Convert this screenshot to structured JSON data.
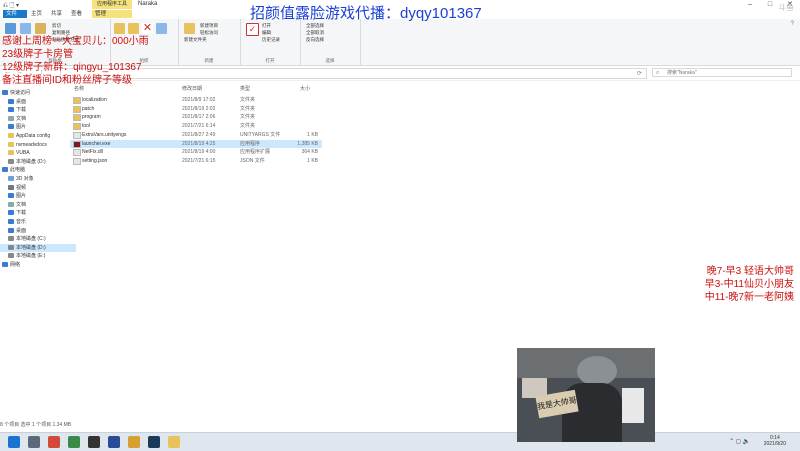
{
  "window": {
    "title": "Naraka",
    "context_tab": "应用程序工具",
    "context_group": "管理",
    "qa_icons": "⎌ 🗋 ▾"
  },
  "ribbon_tabs": [
    "文件",
    "主页",
    "共享",
    "查看"
  ],
  "ribbon": {
    "groups": [
      {
        "label": "剪贴板",
        "items": [
          "固定到快速访问",
          "复制",
          "粘贴",
          "剪切",
          "复制路径",
          "粘贴快捷方式"
        ]
      },
      {
        "label": "组织",
        "items": [
          "移动到",
          "复制到",
          "删除",
          "重命名"
        ]
      },
      {
        "label": "新建",
        "items": [
          "新建文件夹",
          "新建项目",
          "轻松访问"
        ]
      },
      {
        "label": "打开",
        "items": [
          "属性",
          "打开",
          "编辑",
          "历史记录"
        ]
      },
      {
        "label": "选择",
        "items": [
          "全部选择",
          "全部取消",
          "反向选择"
        ]
      }
    ]
  },
  "search": {
    "placeholder": "搜索\"Naraka\""
  },
  "sidebar": [
    {
      "label": "快速访问",
      "icon": "star-icon",
      "color": "#3a7bd5"
    },
    {
      "label": "桌面",
      "icon": "desktop-icon",
      "color": "#3a7bd5"
    },
    {
      "label": "下载",
      "icon": "download-icon",
      "color": "#3a7bd5"
    },
    {
      "label": "文档",
      "icon": "document-icon",
      "color": "#8aa"
    },
    {
      "label": "图片",
      "icon": "picture-icon",
      "color": "#3a7bd5"
    },
    {
      "label": "AppData config",
      "icon": "folder-icon",
      "color": "#e8c25a"
    },
    {
      "label": "nvmeadvdocs",
      "icon": "folder-icon",
      "color": "#e8c25a"
    },
    {
      "label": "VUBA",
      "icon": "folder-icon",
      "color": "#e8c25a"
    },
    {
      "label": "本地磁盘 (D:)",
      "icon": "drive-icon",
      "color": "#888"
    },
    {
      "label": "此电脑",
      "icon": "computer-icon",
      "color": "#3a7bd5"
    },
    {
      "label": "3D 对象",
      "icon": "cube-icon",
      "color": "#6aa0d8"
    },
    {
      "label": "视频",
      "icon": "video-icon",
      "color": "#6a7a8a"
    },
    {
      "label": "图片",
      "icon": "picture-icon",
      "color": "#3a7bd5"
    },
    {
      "label": "文档",
      "icon": "document-icon",
      "color": "#8aa"
    },
    {
      "label": "下载",
      "icon": "download-icon",
      "color": "#3a7bd5"
    },
    {
      "label": "音乐",
      "icon": "music-icon",
      "color": "#3a7bd5"
    },
    {
      "label": "桌面",
      "icon": "desktop-icon",
      "color": "#3a7bd5"
    },
    {
      "label": "本地磁盘 (C:)",
      "icon": "drive-icon",
      "color": "#888"
    },
    {
      "label": "本地磁盘 (D:)",
      "icon": "drive-icon",
      "color": "#888"
    },
    {
      "label": "本地磁盘 (E:)",
      "icon": "drive-icon",
      "color": "#888"
    },
    {
      "label": "网络",
      "icon": "network-icon",
      "color": "#3a7bd5"
    }
  ],
  "sidebar_selected": 18,
  "columns": [
    "名称",
    "修改日期",
    "类型",
    "大小"
  ],
  "files": [
    {
      "name": "localization",
      "date": "2021/8/9 17:02",
      "type": "文件夹",
      "size": "",
      "icon": "folder-icon"
    },
    {
      "name": "patch",
      "date": "2021/8/19 2:02",
      "type": "文件夹",
      "size": "",
      "icon": "folder-icon"
    },
    {
      "name": "program",
      "date": "2021/8/17 2:06",
      "type": "文件夹",
      "size": "",
      "icon": "folder-icon"
    },
    {
      "name": "tool",
      "date": "2021/7/21 6:14",
      "type": "文件夹",
      "size": "",
      "icon": "folder-icon"
    },
    {
      "name": "ExtraVars.unityengs",
      "date": "2021/8/27 2:49",
      "type": "UNITYARGS 文件",
      "size": "1 KB",
      "icon": "file-icon"
    },
    {
      "name": "launcher.exe",
      "date": "2021/8/19 4:25",
      "type": "应用程序",
      "size": "1,385 KB",
      "icon": "app-icon"
    },
    {
      "name": "NetFix.dll",
      "date": "2021/8/19 4:00",
      "type": "应用程序扩展",
      "size": "364 KB",
      "icon": "file-icon"
    },
    {
      "name": "setting.json",
      "date": "2021/7/21 6:15",
      "type": "JSON 文件",
      "size": "1 KB",
      "icon": "file-icon"
    }
  ],
  "selected_file": 5,
  "status": "8 个项目   选中 1 个项目  1.34 MB",
  "taskbar": {
    "apps": [
      {
        "name": "windows-start-icon",
        "color": "#1a73d0"
      },
      {
        "name": "search-taskbar-icon",
        "color": "#5a6a7a"
      },
      {
        "name": "chrome-icon",
        "color": "#d24a3a"
      },
      {
        "name": "game-icon",
        "color": "#3a8a4a"
      },
      {
        "name": "obs-icon",
        "color": "#333333"
      },
      {
        "name": "app-icon",
        "color": "#2a4a9a"
      },
      {
        "name": "tool-icon",
        "color": "#d8a030"
      },
      {
        "name": "steam-icon",
        "color": "#1a3a5a"
      },
      {
        "name": "explorer-icon",
        "color": "#e8c25a"
      }
    ],
    "time": "0:14",
    "date": "2021/9/20"
  },
  "overlay": {
    "title": "招颜值露脸游戏代播：dyqy101367",
    "left_lines": [
      "感谢上周榜一大宝贝儿：000小雨",
      "23级牌子卡房管",
      "12级牌子新群：qingyu_101367",
      "备注直播间ID和粉丝牌子等级"
    ],
    "right_lines": [
      "晚7-早3 轻语大帅哥",
      "早3-中11仙贝小朋友",
      "中11-晚7新一老阿姨"
    ],
    "cam_sign": "我是大帅哥"
  },
  "colors": {
    "accent": "#1979ca",
    "overlay_red": "#cc1010",
    "overlay_blue": "#1a3fd6",
    "selection": "#cce8ff"
  }
}
